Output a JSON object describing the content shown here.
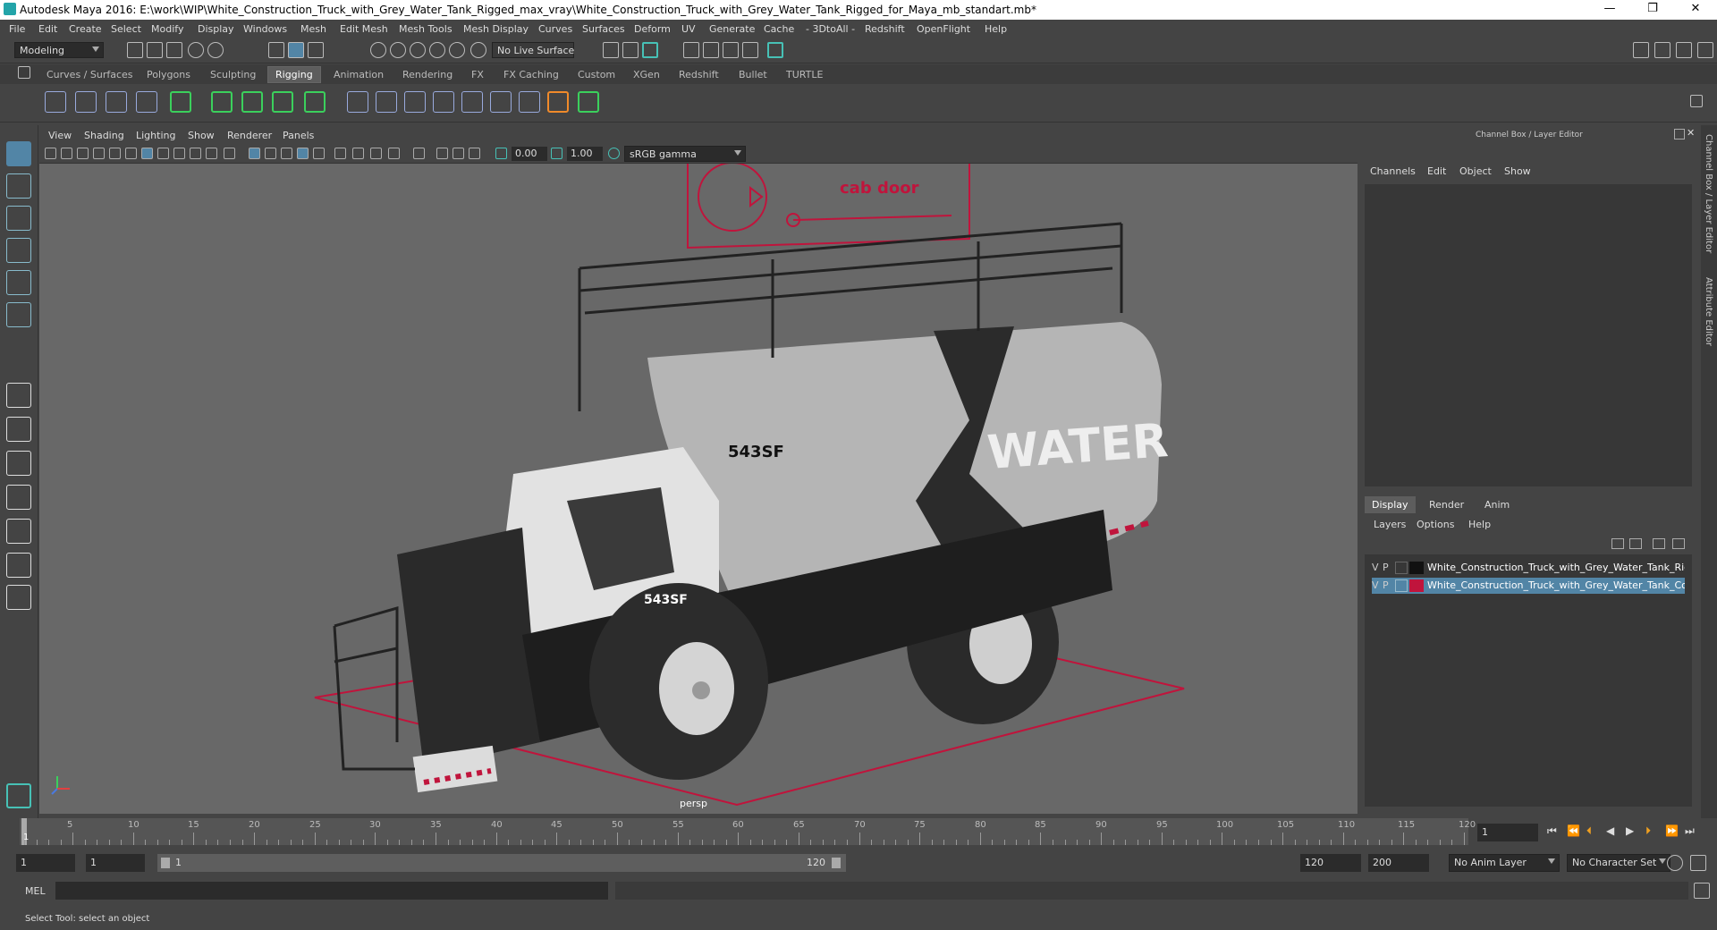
{
  "window": {
    "title": "Autodesk Maya 2016: E:\\work\\WIP\\White_Construction_Truck_with_Grey_Water_Tank_Rigged_max_vray\\White_Construction_Truck_with_Grey_Water_Tank_Rigged_for_Maya_mb_standart.mb*",
    "minimize": "—",
    "restore": "❐",
    "close": "✕"
  },
  "menus": [
    "File",
    "Edit",
    "Create",
    "Select",
    "Modify",
    "Display",
    "Windows",
    "Mesh",
    "Edit Mesh",
    "Mesh Tools",
    "Mesh Display",
    "Curves",
    "Surfaces",
    "Deform",
    "UV",
    "Generate",
    "Cache",
    "- 3DtoAll -",
    "Redshift",
    "OpenFlight",
    "Help"
  ],
  "status": {
    "mode": "Modeling",
    "live_surface": "No Live Surface"
  },
  "shelf_tabs": [
    "Curves / Surfaces",
    "Polygons",
    "Sculpting",
    "Rigging",
    "Animation",
    "Rendering",
    "FX",
    "FX Caching",
    "Custom",
    "XGen",
    "Redshift",
    "Bullet",
    "TURTLE"
  ],
  "active_shelf_tab": "Rigging",
  "viewport": {
    "menus": [
      "View",
      "Shading",
      "Lighting",
      "Show",
      "Renderer",
      "Panels"
    ],
    "exposure": "0.00",
    "gamma": "1.00",
    "colorspace": "sRGB gamma",
    "camera_label": "persp",
    "scene_labels": {
      "cab_door": "cab door",
      "tank_text": "WATER",
      "id_tank": "543SF",
      "id_door": "543SF"
    }
  },
  "channel_box": {
    "title": "Channel Box / Layer Editor",
    "menus": [
      "Channels",
      "Edit",
      "Object",
      "Show"
    ],
    "layer_tabs": [
      "Display",
      "Render",
      "Anim"
    ],
    "active_layer_tab": "Display",
    "layer_menus": [
      "Layers",
      "Options",
      "Help"
    ],
    "layers": [
      {
        "v": "V",
        "p": "P",
        "color": "#111111",
        "name": "White_Construction_Truck_with_Grey_Water_Tank_Rigged",
        "selected": false
      },
      {
        "v": "V",
        "p": "P",
        "color": "#c0143c",
        "name": "White_Construction_Truck_with_Grey_Water_Tank_Controllers",
        "selected": true
      }
    ],
    "side_tabs": [
      "Channel Box / Layer Editor",
      "Attribute Editor"
    ]
  },
  "timeline": {
    "ticks": [
      5,
      10,
      15,
      20,
      25,
      30,
      35,
      40,
      45,
      50,
      55,
      60,
      65,
      70,
      75,
      80,
      85,
      90,
      95,
      100,
      105,
      110,
      115,
      120
    ],
    "current_frame_marker": "1",
    "current_frame": "1"
  },
  "range": {
    "start": "1",
    "playback_start": "1",
    "slider_start": "1",
    "slider_end": "120",
    "playback_end": "120",
    "end": "200",
    "anim_layer": "No Anim Layer",
    "character_set": "No Character Set"
  },
  "mel": {
    "label": "MEL"
  },
  "help_line": "Select Tool: select an object",
  "colors": {
    "accent": "#47c1b6",
    "selection": "#5285a6",
    "rig_red": "#c0143c"
  }
}
